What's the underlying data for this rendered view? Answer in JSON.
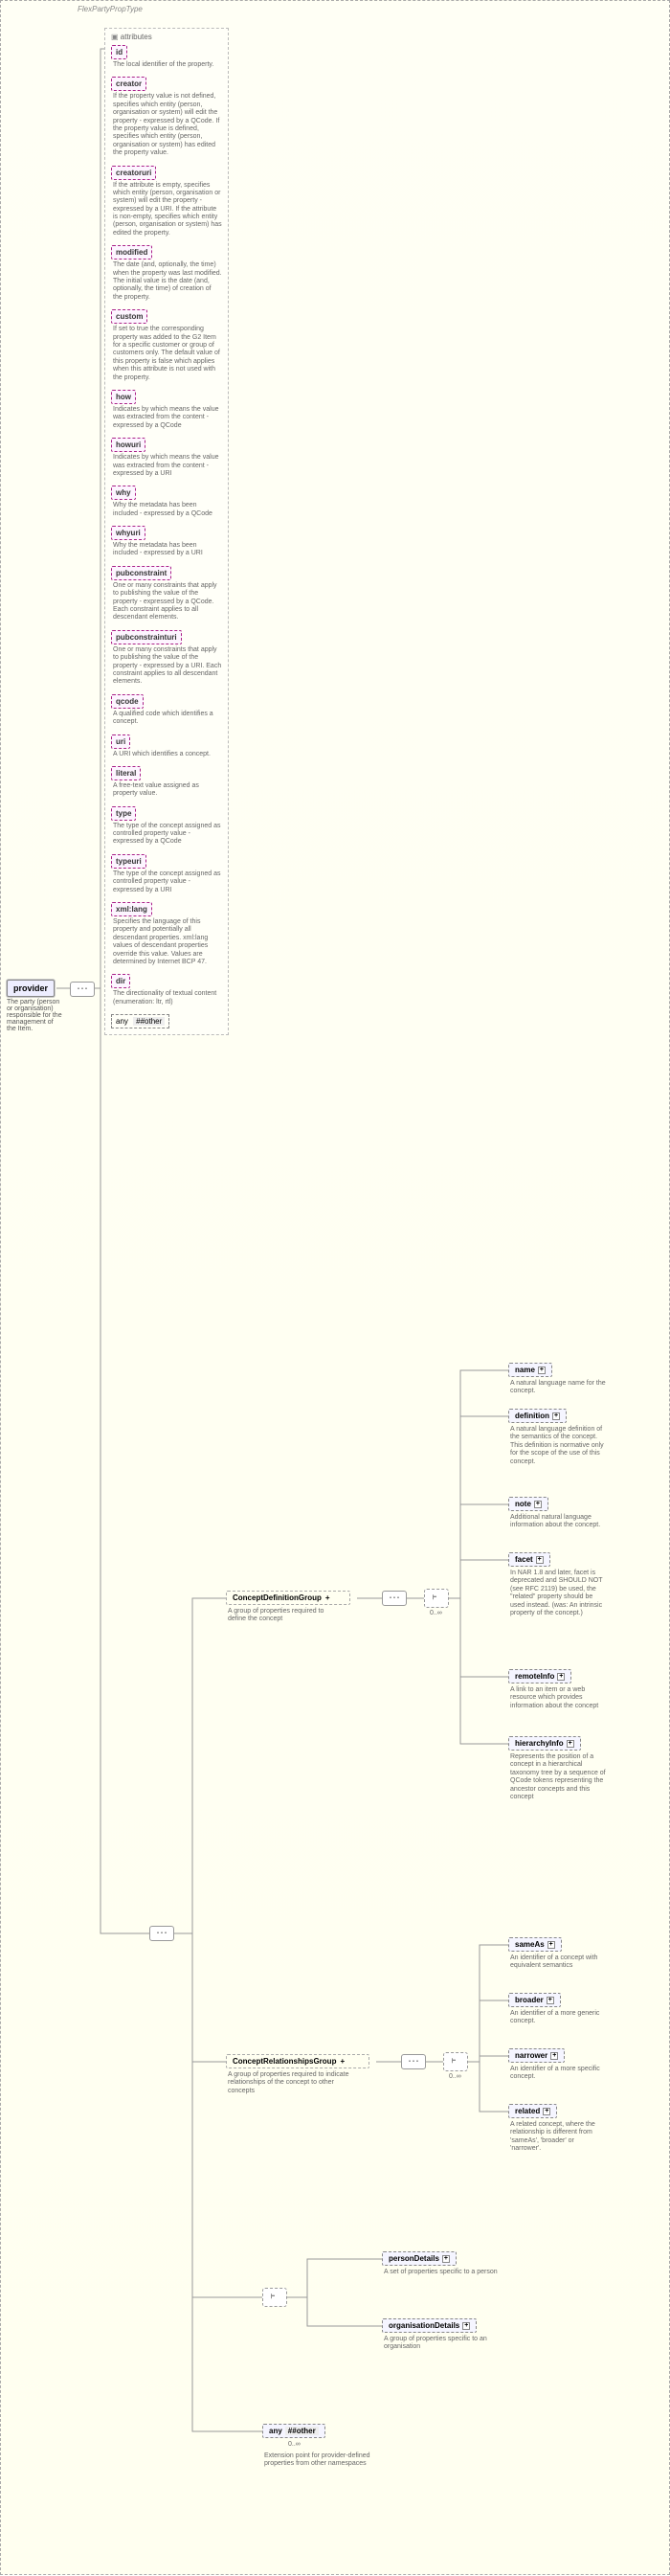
{
  "type_label": "FlexPartyPropType",
  "root": {
    "name": "provider",
    "desc": "The party (person or organisation) responsible for the management of the Item."
  },
  "attributes_label": "attributes",
  "attributes": [
    {
      "name": "id",
      "desc": "The local identifier of the property."
    },
    {
      "name": "creator",
      "desc": "If the property value is not defined, specifies which entity (person, organisation or system) will edit the property - expressed by a QCode. If the property value is defined, specifies which entity (person, organisation or system) has edited the property value."
    },
    {
      "name": "creatoruri",
      "desc": "If the attribute is empty, specifies which entity (person, organisation or system) will edit the property - expressed by a URI. If the attribute is non-empty, specifies which entity (person, organisation or system) has edited the property."
    },
    {
      "name": "modified",
      "desc": "The date (and, optionally, the time) when the property was last modified. The initial value is the date (and, optionally, the time) of creation of the property."
    },
    {
      "name": "custom",
      "desc": "If set to true the corresponding property was added to the G2 Item for a specific customer or group of customers only. The default value of this property is false which applies when this attribute is not used with the property."
    },
    {
      "name": "how",
      "desc": "Indicates by which means the value was extracted from the content - expressed by a QCode"
    },
    {
      "name": "howuri",
      "desc": "Indicates by which means the value was extracted from the content - expressed by a URI"
    },
    {
      "name": "why",
      "desc": "Why the metadata has been included - expressed by a QCode"
    },
    {
      "name": "whyuri",
      "desc": "Why the metadata has been included - expressed by a URI"
    },
    {
      "name": "pubconstraint",
      "desc": "One or many constraints that apply to publishing the value of the property - expressed by a QCode. Each constraint applies to all descendant elements."
    },
    {
      "name": "pubconstrainturi",
      "desc": "One or many constraints that apply to publishing the value of the property - expressed by a URI. Each constraint applies to all descendant elements."
    },
    {
      "name": "qcode",
      "desc": "A qualified code which identifies a concept."
    },
    {
      "name": "uri",
      "desc": "A URI which identifies a concept."
    },
    {
      "name": "literal",
      "desc": "A free-text value assigned as property value."
    },
    {
      "name": "type",
      "desc": "The type of the concept assigned as controlled property value - expressed by a QCode"
    },
    {
      "name": "typeuri",
      "desc": "The type of the concept assigned as controlled property value - expressed by a URI"
    },
    {
      "name": "xml:lang",
      "desc": "Specifies the language of this property and potentially all descendant properties. xml:lang values of descendant properties override this value. Values are determined by Internet BCP 47."
    },
    {
      "name": "dir",
      "desc": "The directionality of textual content (enumeration: ltr, rtl)"
    }
  ],
  "any_other": "##other",
  "any_label": "any",
  "groups": {
    "cdg": {
      "name": "ConceptDefinitionGroup",
      "desc": "A group of properties required to define the concept"
    },
    "crg": {
      "name": "ConceptRelationshipsGroup",
      "desc": "A group of properties required to indicate relationships of the concept to other concepts"
    }
  },
  "cdg_children": [
    {
      "name": "name",
      "desc": "A natural language name for the concept."
    },
    {
      "name": "definition",
      "desc": "A natural language definition of the semantics of the concept. This definition is normative only for the scope of the use of this concept."
    },
    {
      "name": "note",
      "desc": "Additional natural language information about the concept."
    },
    {
      "name": "facet",
      "desc": "In NAR 1.8 and later, facet is deprecated and SHOULD NOT (see RFC 2119) be used, the \"related\" property should be used instead. (was: An intrinsic property of the concept.)"
    },
    {
      "name": "remoteInfo",
      "desc": "A link to an item or a web resource which provides information about the concept"
    },
    {
      "name": "hierarchyInfo",
      "desc": "Represents the position of a concept in a hierarchical taxonomy tree by a sequence of QCode tokens representing the ancestor concepts and this concept"
    }
  ],
  "crg_children": [
    {
      "name": "sameAs",
      "desc": "An identifier of a concept with equivalent semantics"
    },
    {
      "name": "broader",
      "desc": "An identifier of a more generic concept."
    },
    {
      "name": "narrower",
      "desc": "An identifier of a more specific concept."
    },
    {
      "name": "related",
      "desc": "A related concept, where the relationship is different from 'sameAs', 'broader' or 'narrower'."
    }
  ],
  "choice_children": [
    {
      "name": "personDetails",
      "desc": "A set of properties specific to a person"
    },
    {
      "name": "organisationDetails",
      "desc": "A group of properties specific to an organisation"
    }
  ],
  "bottom_any": {
    "label": "any",
    "ns": "##other",
    "card": "0..∞",
    "desc": "Extension point for provider-defined properties from other namespaces"
  },
  "card_0inf": "0..∞"
}
